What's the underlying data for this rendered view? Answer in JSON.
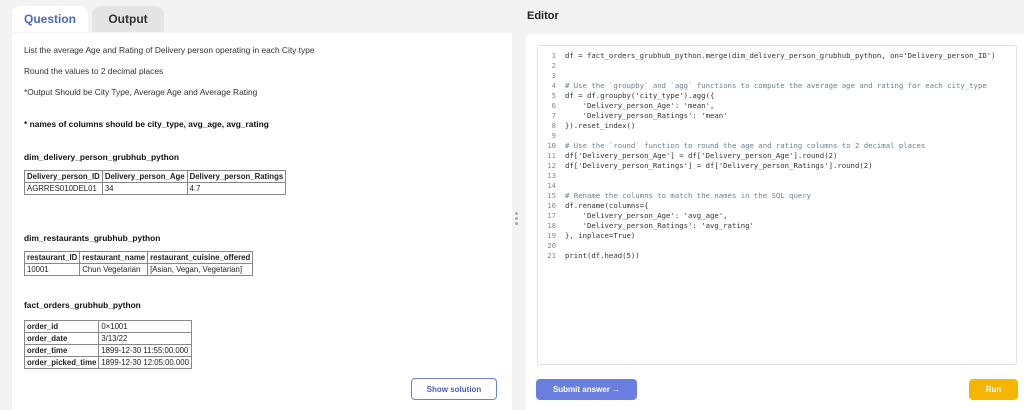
{
  "tabs": {
    "question": "Question",
    "output": "Output"
  },
  "question": {
    "line1": "List the average Age and Rating of Delivery person operating in each City type",
    "line2": "Round the values to 2 decimal places",
    "line3": "*Output Should be City Type, Average Age and Average Rating",
    "line4": "* names of columns should be city_type, avg_age, avg_rating"
  },
  "tables": {
    "t1": {
      "name": "dim_delivery_person_grubhub_python",
      "headers": [
        "Delivery_person_ID",
        "Delivery_person_Age",
        "Delivery_person_Ratings"
      ],
      "row": [
        "AGRRES010DEL01",
        "34",
        "4.7"
      ]
    },
    "t2": {
      "name": "dim_restaurants_grubhub_python",
      "headers": [
        "restaurant_ID",
        "restaurant_name",
        "restaurant_cuisine_offered"
      ],
      "row": [
        "10001",
        "Chun Vegetarian",
        "[Asian, Vegan, Vegetarian]"
      ]
    },
    "t3": {
      "name": "fact_orders_grubhub_python",
      "rows": [
        {
          "k": "order_id",
          "v": "0×1001"
        },
        {
          "k": "order_date",
          "v": "3/13/22"
        },
        {
          "k": "order_time",
          "v": "1899-12-30 11:55:00.000"
        },
        {
          "k": "order_picked_time",
          "v": "1899-12-30 12:05:00.000"
        }
      ]
    }
  },
  "buttons": {
    "show_solution": "Show solution",
    "submit": "Submit answer →",
    "run": "Run"
  },
  "editor": {
    "title": "Editor",
    "lines": [
      "df = fact_orders_grubhub_python.merge(dim_delivery_person_grubhub_python, on='Delivery_person_ID')",
      "",
      "",
      "# Use the `groupby` and `agg` functions to compute the average age and rating for each city_type",
      "df = df.groupby('city_type').agg({",
      "    'Delivery_person_Age': 'mean',",
      "    'Delivery_person_Ratings': 'mean'",
      "}).reset_index()",
      "",
      "# Use the `round` function to round the age and rating columns to 2 decimal places",
      "df['Delivery_person_Age'] = df['Delivery_person_Age'].round(2)",
      "df['Delivery_person_Ratings'] = df['Delivery_person_Ratings'].round(2)",
      "",
      "",
      "# Rename the columns to match the names in the SQL query",
      "df.rename(columns={",
      "    'Delivery_person_Age': 'avg_age',",
      "    'Delivery_person_Ratings': 'avg_rating'",
      "}, inplace=True)",
      "",
      "print(df.head(5))"
    ]
  }
}
